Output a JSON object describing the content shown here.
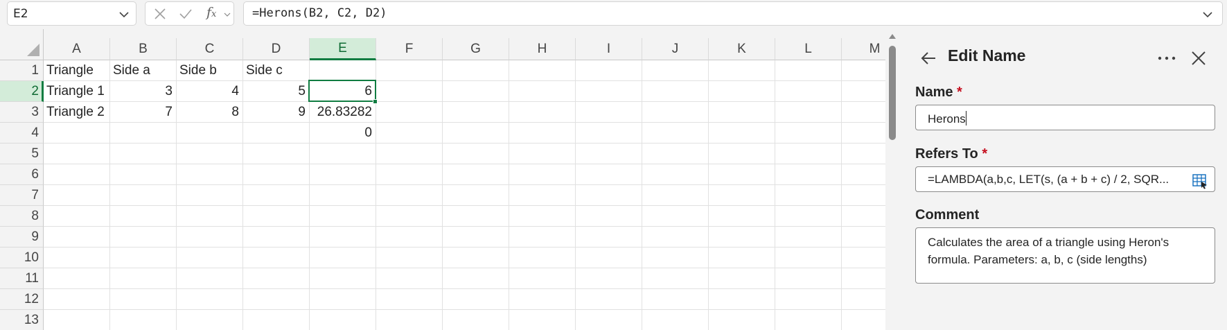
{
  "formula_bar": {
    "name_box": "E2",
    "formula": "=Herons(B2, C2, D2)",
    "cancel_icon": "close-icon",
    "enter_icon": "checkmark-icon",
    "function_icon": "fx-icon"
  },
  "grid": {
    "columns": [
      "A",
      "B",
      "C",
      "D",
      "E",
      "F",
      "G",
      "H",
      "I",
      "J",
      "K",
      "L",
      "M"
    ],
    "rows": [
      "1",
      "2",
      "3",
      "4",
      "5",
      "6",
      "7",
      "8",
      "9",
      "10",
      "11",
      "12",
      "13"
    ],
    "selected_column": "E",
    "selected_row": "2",
    "cells": {
      "A1": "Triangle",
      "B1": "Side a",
      "C1": "Side b",
      "D1": "Side c",
      "A2": "Triangle 1",
      "B2": "3",
      "C2": "4",
      "D2": "5",
      "E2": "6",
      "A3": "Triangle 2",
      "B3": "7",
      "C3": "8",
      "D3": "9",
      "E3": "26.83282",
      "E4": "0"
    }
  },
  "edit_name_pane": {
    "title": "Edit Name",
    "name_label": "Name",
    "name_value": "Herons",
    "refers_to_label": "Refers To",
    "refers_to_value": "=LAMBDA(a,b,c, LET(s, (a + b + c) / 2, SQR...",
    "comment_label": "Comment",
    "comment_value": "Calculates the area of a triangle using Heron's formula. Parameters: a, b, c (side lengths)",
    "required_marker": "*"
  },
  "colors": {
    "accent_green": "#107c41",
    "selected_header_bg": "#d3ecd9",
    "required_red": "#c50f1f"
  }
}
